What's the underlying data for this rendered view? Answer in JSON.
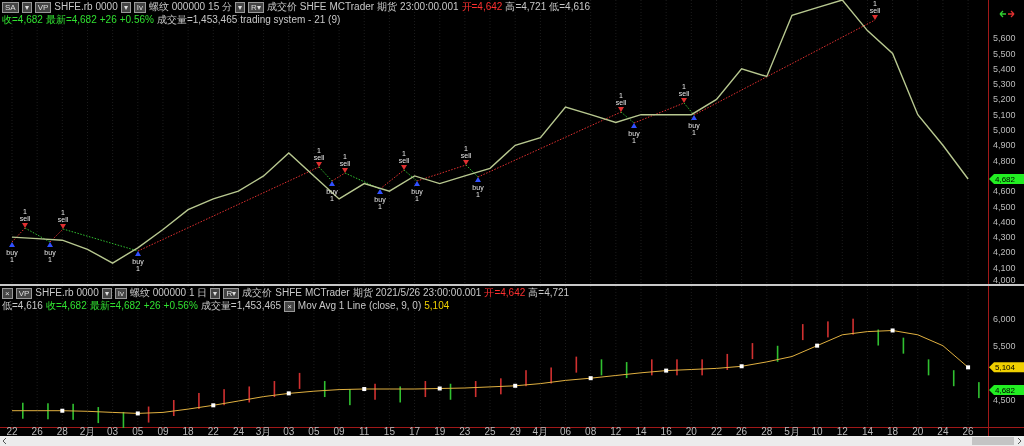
{
  "top_chart": {
    "header": [
      {
        "kind": "button",
        "text": "SA"
      },
      {
        "kind": "button",
        "text": "▾"
      },
      {
        "kind": "button",
        "text": "VP"
      },
      {
        "kind": "text",
        "text": "SHFE.rb 0000"
      },
      {
        "kind": "button",
        "text": "▾"
      },
      {
        "kind": "button",
        "text": "Iv"
      },
      {
        "kind": "text",
        "text": "螺纹 000000"
      },
      {
        "kind": "text",
        "text": "15 分"
      },
      {
        "kind": "button",
        "text": "▾"
      },
      {
        "kind": "button",
        "text": "R▾"
      },
      {
        "kind": "text",
        "text": "成交价"
      },
      {
        "kind": "text",
        "text": "SHFE"
      },
      {
        "kind": "text",
        "text": "MCTrader"
      },
      {
        "kind": "text",
        "text": "期货"
      },
      {
        "kind": "text",
        "text": "23:00:00.001"
      },
      {
        "kind": "text",
        "text": "开=4,642",
        "color": "#ff3030"
      },
      {
        "kind": "text",
        "text": "高=4,721"
      },
      {
        "kind": "text",
        "text": "低=4,616"
      },
      {
        "kind": "text",
        "text": "收=4,682",
        "color": "#30e030"
      },
      {
        "kind": "text",
        "text": "最新=4,682",
        "color": "#30e030"
      },
      {
        "kind": "text",
        "text": "+26",
        "color": "#30e030"
      },
      {
        "kind": "text",
        "text": "+0.56%",
        "color": "#30e030"
      },
      {
        "kind": "text",
        "text": "成交量=1,453,465"
      },
      {
        "kind": "text",
        "text": "trading system - 21 (9)"
      }
    ],
    "last_price_label": "4,682",
    "chart_data": {
      "type": "line",
      "grid": true,
      "ylim": [
        4000,
        5850
      ],
      "categories": [
        null,
        null,
        null,
        null,
        null,
        null,
        null,
        null,
        null,
        null,
        null,
        null,
        null,
        null,
        null,
        null,
        null,
        null,
        null,
        null,
        null,
        null,
        null,
        null,
        null,
        null,
        null,
        null,
        null,
        null,
        null,
        null,
        null,
        null,
        null,
        null,
        null,
        null,
        null
      ],
      "yticks": [
        {
          "value": 4000,
          "label": "4,000"
        },
        {
          "value": 4100,
          "label": "4,100"
        },
        {
          "value": 4200,
          "label": "4,200"
        },
        {
          "value": 4300,
          "label": "4,300"
        },
        {
          "value": 4400,
          "label": "4,400"
        },
        {
          "value": 4500,
          "label": "4,500"
        },
        {
          "value": 4600,
          "label": "4,600"
        },
        {
          "value": 4800,
          "label": "4,800"
        },
        {
          "value": 4900,
          "label": "4,900"
        },
        {
          "value": 5000,
          "label": "5,000"
        },
        {
          "value": 5100,
          "label": "5,100"
        },
        {
          "value": 5200,
          "label": "5,200"
        },
        {
          "value": 5300,
          "label": "5,300"
        },
        {
          "value": 5400,
          "label": "5,400"
        },
        {
          "value": 5500,
          "label": "5,500"
        },
        {
          "value": 5600,
          "label": "5,600"
        }
      ],
      "series": [
        {
          "color": "#b8c890",
          "values": [
            4300,
            4290,
            4280,
            4220,
            4130,
            4230,
            4350,
            4480,
            4550,
            4600,
            4700,
            4850,
            4700,
            4550,
            4650,
            4600,
            4700,
            4650,
            4700,
            4750,
            4900,
            4950,
            5150,
            5100,
            5050,
            5100,
            5100,
            5100,
            5200,
            5400,
            5350,
            5750,
            5800,
            5850,
            5650,
            5500,
            5100,
            4900,
            4680
          ]
        }
      ]
    },
    "signals": [
      {
        "kind": "buy",
        "label": "buy",
        "quantity": "1"
      },
      {
        "kind": "sell",
        "label": "sell",
        "quantity": "1"
      },
      {
        "kind": "buy",
        "label": "buy",
        "quantity": "1"
      },
      {
        "kind": "sell",
        "label": "sell",
        "quantity": "1"
      },
      {
        "kind": "buy",
        "label": "buy",
        "quantity": "1"
      },
      {
        "kind": "sell",
        "label": "sell",
        "quantity": "1"
      },
      {
        "kind": "buy",
        "label": "buy",
        "quantity": "1"
      },
      {
        "kind": "sell",
        "label": "sell",
        "quantity": "1"
      },
      {
        "kind": "buy",
        "label": "buy",
        "quantity": "1"
      },
      {
        "kind": "sell",
        "label": "sell",
        "quantity": "1"
      },
      {
        "kind": "buy",
        "label": "buy",
        "quantity": "1"
      },
      {
        "kind": "sell",
        "label": "sell",
        "quantity": "1"
      },
      {
        "kind": "buy",
        "label": "buy",
        "quantity": "1"
      },
      {
        "kind": "sell",
        "label": "sell",
        "quantity": "1"
      },
      {
        "kind": "buy",
        "label": "buy",
        "quantity": "1"
      },
      {
        "kind": "sell",
        "label": "sell",
        "quantity": "1"
      },
      {
        "kind": "buy",
        "label": "buy",
        "quantity": "1"
      },
      {
        "kind": "sell",
        "label": "sell",
        "quantity": "1"
      }
    ]
  },
  "bottom_chart": {
    "header": [
      {
        "kind": "button",
        "text": "×"
      },
      {
        "kind": "button",
        "text": "VP"
      },
      {
        "kind": "text",
        "text": "SHFE.rb 0000"
      },
      {
        "kind": "button",
        "text": "▾"
      },
      {
        "kind": "button",
        "text": "Iv"
      },
      {
        "kind": "text",
        "text": "螺纹 000000"
      },
      {
        "kind": "text",
        "text": "1 日"
      },
      {
        "kind": "button",
        "text": "▾"
      },
      {
        "kind": "button",
        "text": "R▾"
      },
      {
        "kind": "text",
        "text": "成交价"
      },
      {
        "kind": "text",
        "text": "SHFE"
      },
      {
        "kind": "text",
        "text": "MCTrader"
      },
      {
        "kind": "text",
        "text": "期货"
      },
      {
        "kind": "text",
        "text": "2021/5/26"
      },
      {
        "kind": "text",
        "text": "23:00:00.001"
      },
      {
        "kind": "text",
        "text": "开=4,642",
        "color": "#ff3030"
      },
      {
        "kind": "text",
        "text": "高=4,721"
      },
      {
        "kind": "text",
        "text": "低=4,616"
      },
      {
        "kind": "text",
        "text": "收=4,682",
        "color": "#30e030"
      },
      {
        "kind": "text",
        "text": "最新=4,682",
        "color": "#30e030"
      },
      {
        "kind": "text",
        "text": "+26",
        "color": "#30e030"
      },
      {
        "kind": "text",
        "text": "+0.56%",
        "color": "#30e030"
      },
      {
        "kind": "text",
        "text": "成交量=1,453,465"
      },
      {
        "kind": "button",
        "text": "×"
      },
      {
        "kind": "text",
        "text": "Mov Avg 1 Line"
      },
      {
        "kind": "text",
        "text": "(close, 9, 0)"
      },
      {
        "kind": "text",
        "text": "5,104",
        "color": "#f0d000"
      }
    ],
    "ma_label": "5,104",
    "last_price_label": "4,682",
    "chart_data": {
      "type": "line",
      "grid": true,
      "ylim": [
        4000,
        6600
      ],
      "categories": [
        "22",
        "26",
        "28",
        "2月",
        "03",
        "05",
        "09",
        "18",
        "22",
        "24",
        "3月",
        "03",
        "05",
        "09",
        "11",
        "15",
        "17",
        "19",
        "23",
        "25",
        "29",
        "4月",
        "06",
        "08",
        "12",
        "14",
        "16",
        "20",
        "22",
        "26",
        "28",
        "5月",
        "10",
        "12",
        "14",
        "18",
        "20",
        "24",
        "26"
      ],
      "yticks": [
        {
          "value": 4500,
          "label": "4,500"
        },
        {
          "value": 5500,
          "label": "5,500"
        },
        {
          "value": 6000,
          "label": "6,000"
        }
      ],
      "series": [
        {
          "color": "#e0b040",
          "values": [
            4300,
            4300,
            4300,
            4290,
            4270,
            4250,
            4270,
            4330,
            4400,
            4480,
            4560,
            4620,
            4660,
            4690,
            4700,
            4700,
            4700,
            4710,
            4720,
            4740,
            4760,
            4800,
            4860,
            4900,
            4950,
            5000,
            5040,
            5060,
            5080,
            5120,
            5200,
            5300,
            5500,
            5700,
            5760,
            5780,
            5700,
            5500,
            5100
          ]
        }
      ]
    }
  }
}
